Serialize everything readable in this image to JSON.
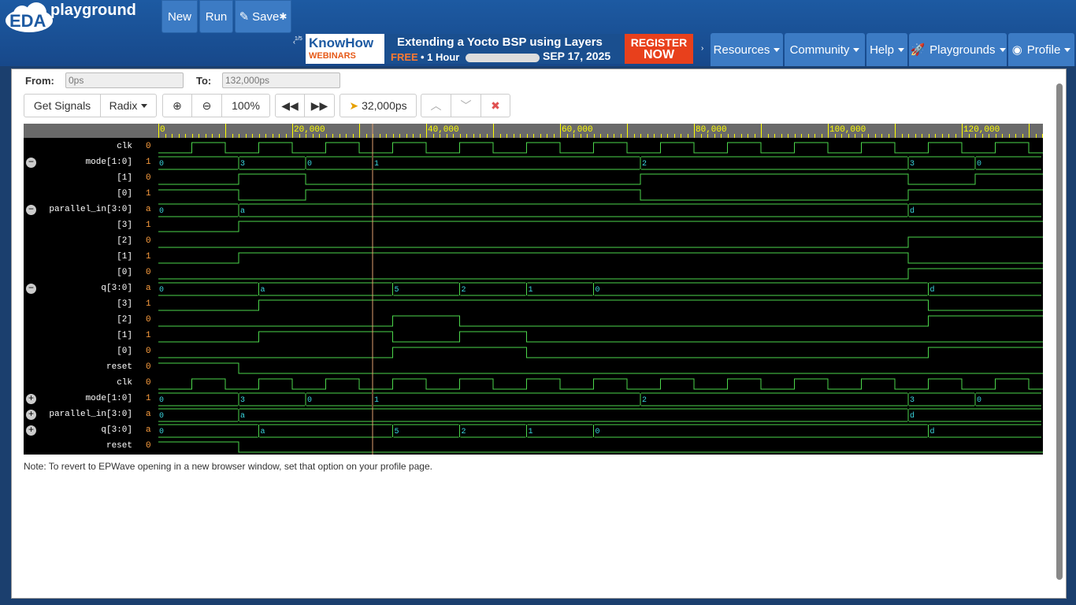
{
  "app": {
    "logo_text": "EDA",
    "logo_sub": "playground"
  },
  "toolbar": {
    "new_label": "New",
    "run_label": "Run",
    "save_label": "Save"
  },
  "banner": {
    "page": "1/5",
    "brand": "KnowHow",
    "brand_sub": "WEBINARS",
    "headline": "Extending a Yocto BSP using Layers",
    "free": "FREE",
    "duration": "• 1 Hour",
    "date": "SEP 17, 2025",
    "cta1": "REGISTER",
    "cta2": "NOW"
  },
  "nav": {
    "resources": "Resources",
    "community": "Community",
    "help": "Help",
    "playgrounds": "Playgrounds",
    "profile": "Profile"
  },
  "range": {
    "from_label": "From:",
    "from_value": "0ps",
    "to_label": "To:",
    "to_value": "132,000ps"
  },
  "controls": {
    "get_signals": "Get Signals",
    "radix": "Radix",
    "zoom": "100%",
    "cursor": "32,000ps"
  },
  "ruler_ticks": [
    "0",
    "20,000",
    "40,000",
    "60,000",
    "80,000",
    "100,000",
    "120,000"
  ],
  "signals": [
    {
      "name": "clk",
      "value": "0",
      "toggle": ""
    },
    {
      "name": "mode[1:0]",
      "value": "1",
      "toggle": "−"
    },
    {
      "name": "[1]",
      "value": "0",
      "toggle": ""
    },
    {
      "name": "[0]",
      "value": "1",
      "toggle": ""
    },
    {
      "name": "parallel_in[3:0]",
      "value": "a",
      "toggle": "−"
    },
    {
      "name": "[3]",
      "value": "1",
      "toggle": ""
    },
    {
      "name": "[2]",
      "value": "0",
      "toggle": ""
    },
    {
      "name": "[1]",
      "value": "1",
      "toggle": ""
    },
    {
      "name": "[0]",
      "value": "0",
      "toggle": ""
    },
    {
      "name": "q[3:0]",
      "value": "a",
      "toggle": "−"
    },
    {
      "name": "[3]",
      "value": "1",
      "toggle": ""
    },
    {
      "name": "[2]",
      "value": "0",
      "toggle": ""
    },
    {
      "name": "[1]",
      "value": "1",
      "toggle": ""
    },
    {
      "name": "[0]",
      "value": "0",
      "toggle": ""
    },
    {
      "name": "reset",
      "value": "0",
      "toggle": ""
    },
    {
      "name": "clk",
      "value": "0",
      "toggle": ""
    },
    {
      "name": "mode[1:0]",
      "value": "1",
      "toggle": "+"
    },
    {
      "name": "parallel_in[3:0]",
      "value": "a",
      "toggle": "+"
    },
    {
      "name": "q[3:0]",
      "value": "a",
      "toggle": "+"
    },
    {
      "name": "reset",
      "value": "0",
      "toggle": ""
    }
  ],
  "bus_labels": {
    "mode": [
      "0",
      "3",
      "0",
      "1",
      "2",
      "3",
      "0"
    ],
    "parallel_in": [
      "0",
      "a",
      "d"
    ],
    "q": [
      "0",
      "a",
      "5",
      "2",
      "1",
      "0",
      "d"
    ]
  },
  "note": "Note: To revert to EPWave opening in a new browser window, set that option on your profile page.",
  "colors": {
    "wave_green": "#4bd64b",
    "wave_cyan": "#3ad7e0",
    "value_orange": "#ffa040",
    "ruler": "#ffff00",
    "cursor": "#e0a070"
  }
}
